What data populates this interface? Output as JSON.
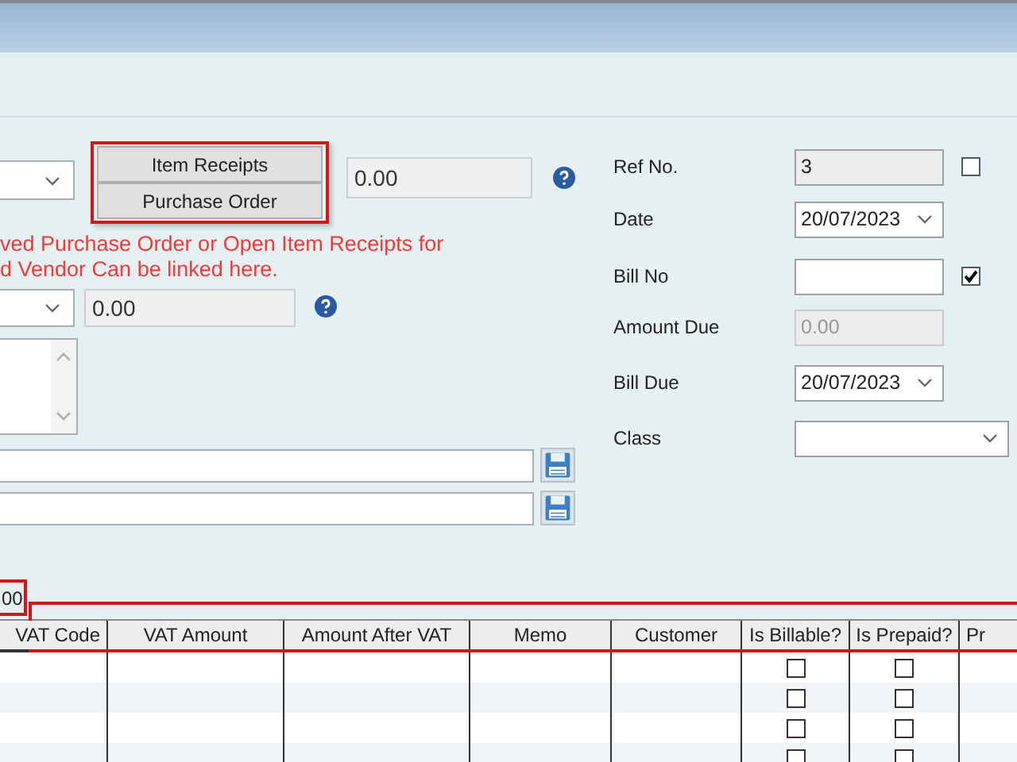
{
  "link_buttons": [
    "Item Receipts",
    "Purchase Order"
  ],
  "amount_field": {
    "value": "0.00"
  },
  "link_note": [
    "ved Purchase Order or Open Item Receipts for",
    "d Vendor Can be linked here."
  ],
  "second_amount_field": {
    "value": "0.00"
  },
  "total_field": {
    "value": "00"
  },
  "right_form": [
    {
      "kind": "text",
      "label": "Ref No.",
      "value": "3",
      "disabled": true,
      "checkbox": {
        "checked": false
      }
    },
    {
      "kind": "dropdown",
      "label": "Date",
      "value": "20/07/2023"
    },
    {
      "kind": "text",
      "label": "Bill No",
      "disabled": false,
      "checkbox": {
        "checked": true
      }
    },
    {
      "kind": "text",
      "label": "Amount Due",
      "value": "0.00",
      "disabled": true
    },
    {
      "kind": "dropdown",
      "label": "Bill Due",
      "value": "20/07/2023"
    },
    {
      "kind": "dropdown",
      "label": "Class"
    }
  ],
  "table": {
    "columns": [
      "VAT Code",
      "VAT Amount",
      "Amount After VAT",
      "Memo",
      "Customer",
      "Is Billable?",
      "Is Prepaid?",
      "Pr"
    ],
    "rows": [
      {
        "is_billable": false,
        "is_prepaid": false
      },
      {
        "is_billable": false,
        "is_prepaid": false
      },
      {
        "is_billable": false,
        "is_prepaid": false
      },
      {
        "is_billable": false,
        "is_prepaid": false
      }
    ]
  }
}
